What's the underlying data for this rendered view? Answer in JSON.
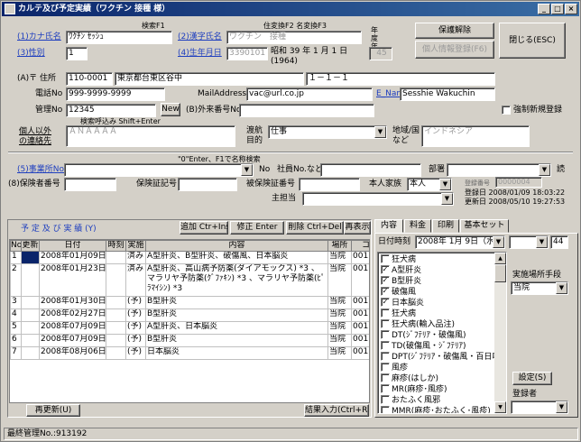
{
  "window": {
    "title": "カルテ及び予定実績（ワクチン 接種 様）",
    "min": "_",
    "max": "□",
    "close": "×"
  },
  "header": {
    "kana_label": "(1)カナ氏名",
    "kana_value": "ﾜｸﾁﾝ ｾｯｼｭ",
    "search_f1": "検索F1",
    "kanji_label": "(2)漢字氏名",
    "kanji_value": "ワクチン　接種",
    "kanji_hint": "住変換F2 名変換F3",
    "sex_label": "(3)性別",
    "sex_value": "1",
    "birth_label": "(4)生年月日",
    "birth_value": "3390101",
    "birth_text1": "昭和 39 年 1 月 1 日",
    "birth_text2": "(1964)",
    "age_label": "年度年齢",
    "age_value": "45",
    "btn_protect": "保護解除",
    "btn_personal": "個人情報登録(F6)",
    "btn_close": "閉じる(ESC)"
  },
  "address": {
    "label": "(A)〒 住所",
    "zip": "110-0001",
    "addr1": "東京都台東区谷中",
    "addr2": "１－１－１",
    "tel_label": "電話No",
    "tel": "999-9999-9999",
    "mail_label": "MailAddress",
    "mail": "vac@url.co.jp",
    "ename_label": "E_Name",
    "ename": "Sesshie Wakuchin",
    "mgmt_label": "管理No",
    "mgmt": "12345",
    "new_btn": "New",
    "foreign_label": "(B)外来番号No",
    "force_label": "強制新規登録",
    "other_label1": "個人以外",
    "other_label2": "の連絡先",
    "other_value": "ＡＮＡＡＡＡ",
    "search_hint": "検索呼込み Shift+Enter",
    "travel_label1": "渡航",
    "travel_label2": "目的",
    "travel_value": "仕事",
    "region_label1": "地域/国",
    "region_label2": "など",
    "region_value": "インドネシア"
  },
  "employer": {
    "hint": "\"0\"Enter、F1で名称検索",
    "office_label": "(5)事業所No",
    "no_label": "No",
    "staff_label": "社員No.など",
    "dept_label": "部署",
    "read_label": "読",
    "insurer_label": "(8)保険者番号",
    "card_label": "保険証記号",
    "insured_label": "被保険証番号",
    "family_label": "本人家族",
    "family_value": "本人",
    "reg_no_label": "登録番号",
    "reg_no": "0000004",
    "reg_date": "登録日 2008/01/09 18:03:22",
    "upd_date": "更新日 2008/05/10 19:27:53",
    "doctor_label": "主担当"
  },
  "schedule": {
    "title": "予 定 及 び 実 績 (Y)",
    "btn_add": "追加 Ctr+Ins",
    "btn_edit": "修正 Enter",
    "btn_del": "削除 Ctrl+Del",
    "btn_show": "再表示",
    "columns": [
      "No",
      "更新",
      "日付",
      "時刻",
      "実施",
      "内容",
      "場所",
      "コ"
    ],
    "rows": [
      {
        "no": "1",
        "upd": "",
        "date": "2008年01月09日(水)",
        "time": "",
        "done": "済み",
        "content": "A型肝炎、B型肝炎、破傷風、日本脳炎",
        "place": "当院",
        "c": "001"
      },
      {
        "no": "2",
        "upd": "",
        "date": "2008年01月23日(水)",
        "time": "",
        "done": "済み",
        "content": "A型肝炎、高山病予防薬(ダイアモックス) *3 、マラリヤ予防薬(ｸﾞﾌｧｷﾝ) *3 、マラリヤ予防薬(ﾋﾟﾗﾏｲｼﾝ) *3",
        "place": "当院",
        "c": "001"
      },
      {
        "no": "3",
        "upd": "",
        "date": "2008年01月30日(水)",
        "time": "",
        "done": "(予)",
        "content": "B型肝炎",
        "place": "当院",
        "c": "001"
      },
      {
        "no": "4",
        "upd": "",
        "date": "2008年02月27日(水)",
        "time": "",
        "done": "(予)",
        "content": "B型肝炎",
        "place": "当院",
        "c": "001"
      },
      {
        "no": "5",
        "upd": "",
        "date": "2008年07月09日(水)",
        "time": "",
        "done": "(予)",
        "content": "A型肝炎、日本脳炎",
        "place": "当院",
        "c": "001"
      },
      {
        "no": "6",
        "upd": "",
        "date": "2008年07月09日(水)",
        "time": "",
        "done": "(予)",
        "content": "B型肝炎",
        "place": "当院",
        "c": "001"
      },
      {
        "no": "7",
        "upd": "",
        "date": "2008年08月06日(水)",
        "time": "",
        "done": "(予)",
        "content": "日本脳炎",
        "place": "当院",
        "c": "001"
      }
    ],
    "btn_refresh": "再更新(U)",
    "btn_result": "結果入力(Ctrl+R)"
  },
  "panel": {
    "tabs": [
      "内容",
      "料金",
      "印刷",
      "基本セット"
    ],
    "datetime_label": "日付時刻",
    "date_value": "2008年 1月 9日（水）",
    "count_value": "44",
    "vaccines": [
      {
        "name": "狂犬病",
        "checked": false
      },
      {
        "name": "A型肝炎",
        "checked": true
      },
      {
        "name": "B型肝炎",
        "checked": true
      },
      {
        "name": "破傷風",
        "checked": true
      },
      {
        "name": "日本脳炎",
        "checked": true
      },
      {
        "name": "狂犬病",
        "checked": false
      },
      {
        "name": "狂犬病(輸入品注)",
        "checked": false
      },
      {
        "name": "DT(ｼﾞﾌﾃﾘｱ・破傷風)",
        "checked": false
      },
      {
        "name": "TD(破傷風・ｼﾞﾌﾃﾘｱ)",
        "checked": false
      },
      {
        "name": "DPT(ｼﾞﾌﾃﾘｱ・破傷風・百日咳)",
        "checked": false
      },
      {
        "name": "風疹",
        "checked": false
      },
      {
        "name": "麻疹(はしか)",
        "checked": false
      },
      {
        "name": "MR(麻疹･風疹)",
        "checked": false
      },
      {
        "name": "おたふく風邪",
        "checked": false
      },
      {
        "name": "MMR(麻疹･おたふく･風疹)",
        "checked": false
      }
    ],
    "place_label": "実施場所手段",
    "place_value": "当院",
    "btn_settings": "設定(S)",
    "registrant_label": "登録者"
  },
  "status": {
    "text": "最終管理No.:913192"
  }
}
